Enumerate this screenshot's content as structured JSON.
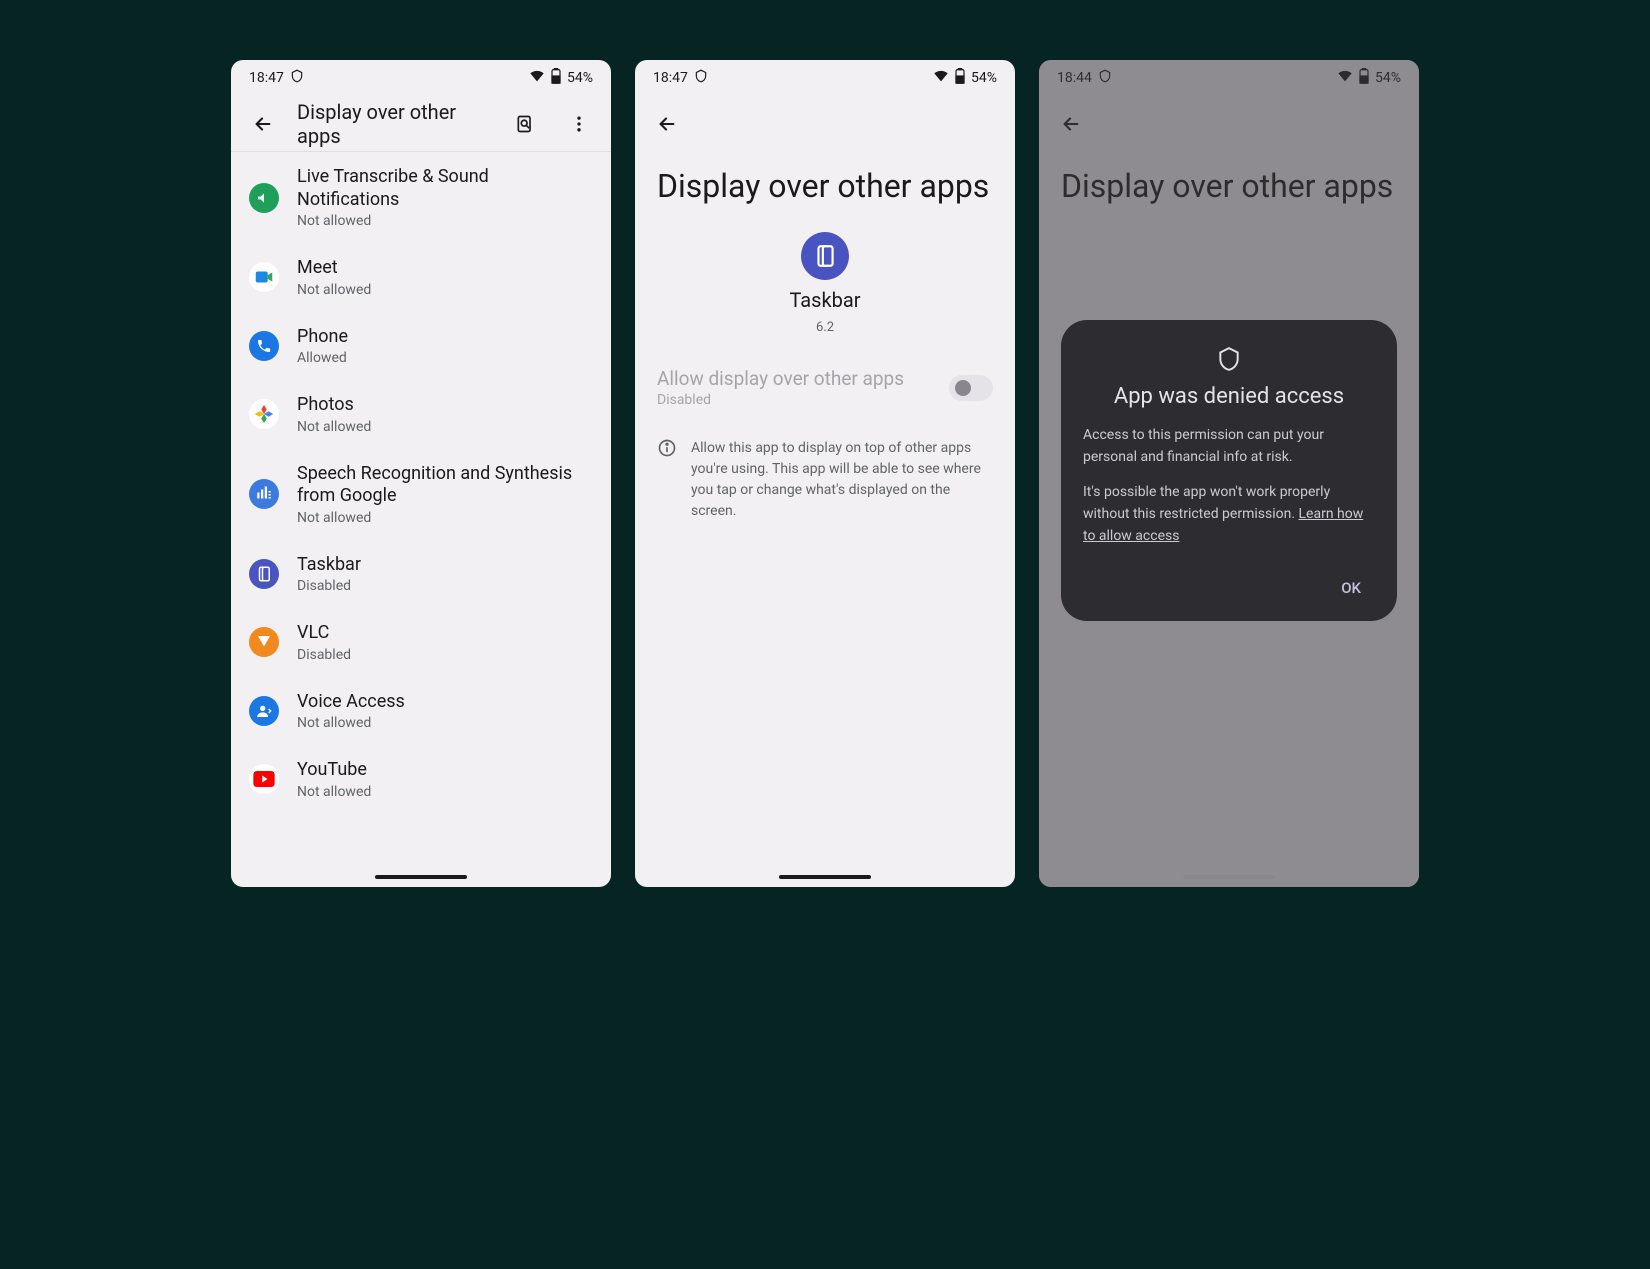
{
  "screen1": {
    "status": {
      "time": "18:47",
      "battery": "54%"
    },
    "title": "Display over other apps",
    "apps": [
      {
        "name": "Live Transcribe & Sound Notifications",
        "status": "Not allowed",
        "color": "#1fa05a"
      },
      {
        "name": "Meet",
        "status": "Not allowed",
        "color": "#ffffff"
      },
      {
        "name": "Phone",
        "status": "Allowed",
        "color": "#1b77e4"
      },
      {
        "name": "Photos",
        "status": "Not allowed",
        "color": "#ffffff"
      },
      {
        "name": "Speech Recognition and Synthesis from Google",
        "status": "Not allowed",
        "color": "#3b7be0"
      },
      {
        "name": "Taskbar",
        "status": "Disabled",
        "color": "#4a54c1"
      },
      {
        "name": "VLC",
        "status": "Disabled",
        "color": "#f08a1f"
      },
      {
        "name": "Voice Access",
        "status": "Not allowed",
        "color": "#1b77e4"
      },
      {
        "name": "YouTube",
        "status": "Not allowed",
        "color": "#ffffff"
      }
    ]
  },
  "screen2": {
    "status": {
      "time": "18:47",
      "battery": "54%"
    },
    "title": "Display over other apps",
    "app": {
      "name": "Taskbar",
      "version": "6.2"
    },
    "toggle": {
      "title": "Allow display over other apps",
      "sub": "Disabled"
    },
    "info": "Allow this app to display on top of other apps you're using. This app will be able to see where you tap or change what's displayed on the screen."
  },
  "screen3": {
    "status": {
      "time": "18:44",
      "battery": "54%"
    },
    "title": "Display over other apps",
    "dialog": {
      "title": "App was denied access",
      "body1": "Access to this permission can put your personal and financial info at risk.",
      "body2a": "It's possible the app won't work properly without this restricted permission. ",
      "link": "Learn how to allow access",
      "ok": "OK"
    }
  }
}
